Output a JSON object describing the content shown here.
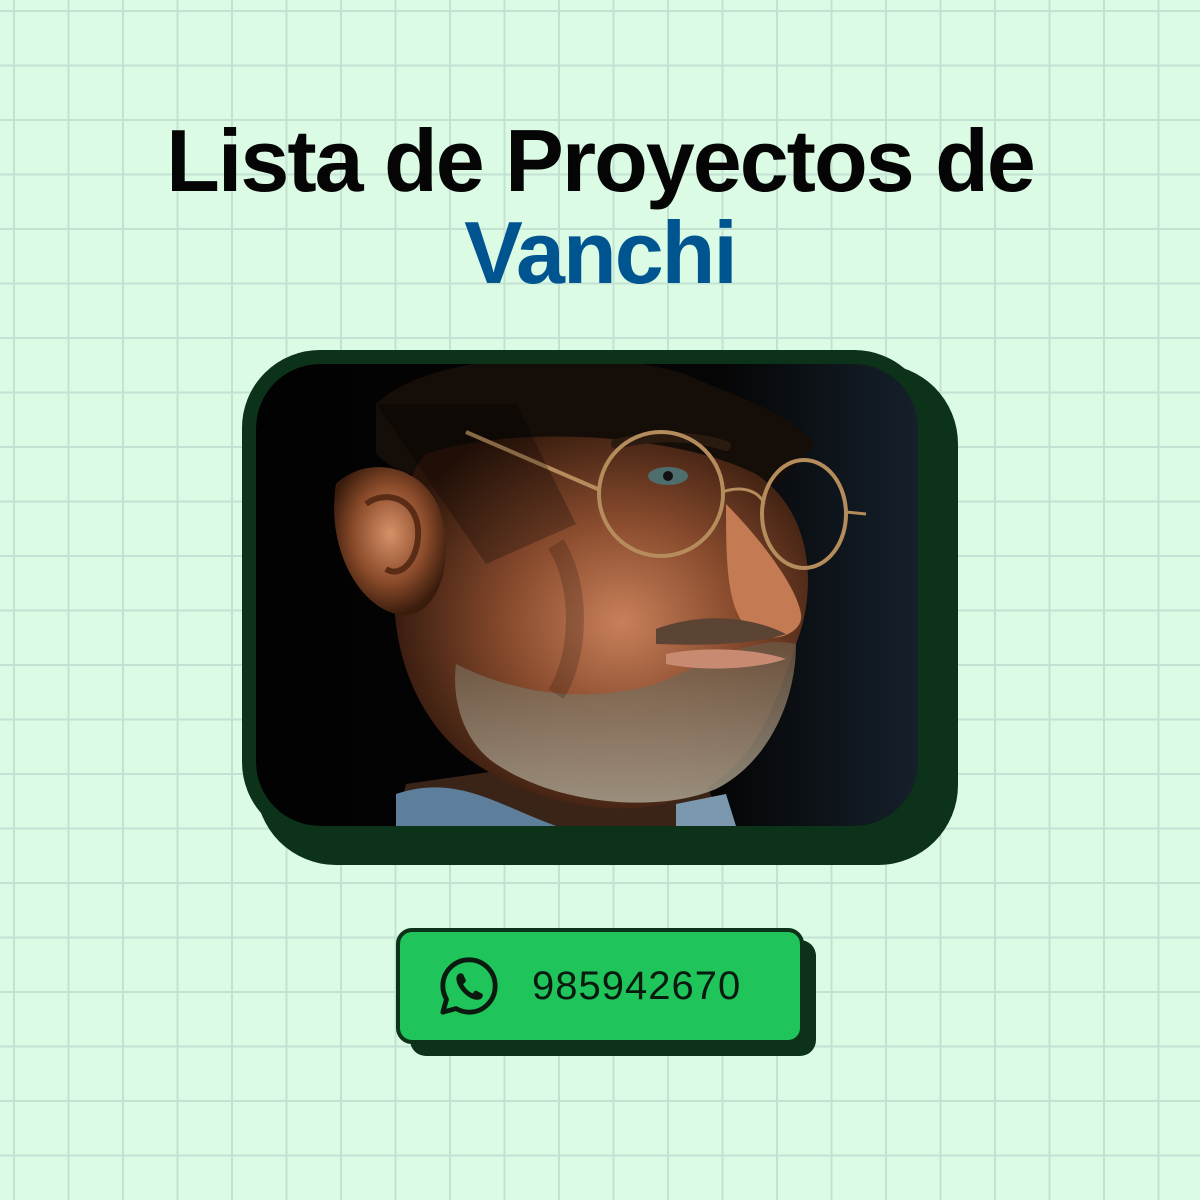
{
  "heading": {
    "line1": "Lista de Proyectos de",
    "highlight": "Vanchi",
    "highlight_color": "#005590"
  },
  "photo": {
    "subject": "portrait of man with round glasses and beard in dramatic light"
  },
  "contact": {
    "icon": "whatsapp-icon",
    "phone": "985942670",
    "button_color": "#1fc45a",
    "outline_color": "#0c3219"
  }
}
